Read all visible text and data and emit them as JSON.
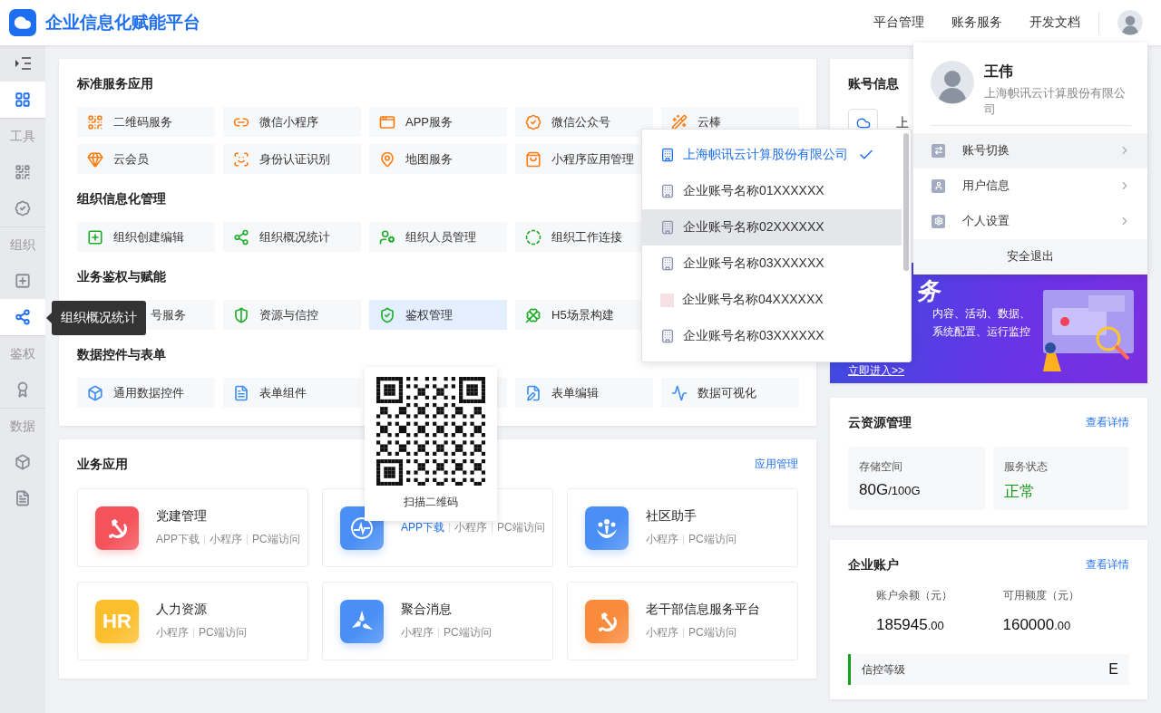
{
  "header": {
    "title": "企业信息化赋能平台",
    "nav": [
      "平台管理",
      "账务服务",
      "开发文档"
    ]
  },
  "sidebar": {
    "items": [
      {
        "kind": "toggle",
        "selected": false
      },
      {
        "kind": "grid",
        "selected": true
      },
      {
        "kind": "label",
        "label": "工具",
        "selected": false
      },
      {
        "kind": "qr",
        "selected": false
      },
      {
        "kind": "badge",
        "selected": false
      },
      {
        "kind": "label",
        "label": "组织",
        "selected": false
      },
      {
        "kind": "add",
        "selected": false
      },
      {
        "kind": "nodes",
        "selected": true
      },
      {
        "kind": "label",
        "label": "鉴权",
        "selected": false
      },
      {
        "kind": "medal",
        "selected": false
      },
      {
        "kind": "label",
        "label": "数据",
        "selected": false
      },
      {
        "kind": "cube",
        "selected": false
      },
      {
        "kind": "doc",
        "selected": false
      }
    ]
  },
  "services": {
    "sections": [
      {
        "title": "标准服务应用",
        "items": [
          {
            "kind": "qr",
            "label": "二维码服务",
            "selected": false
          },
          {
            "kind": "miniapp",
            "label": "微信小程序",
            "selected": false
          },
          {
            "kind": "app",
            "label": "APP服务",
            "selected": false
          },
          {
            "kind": "badge",
            "label": "微信公众号",
            "selected": false
          },
          {
            "kind": "wand",
            "label": "云棒",
            "selected": false
          },
          {
            "kind": "gem",
            "label": "云会员",
            "selected": false
          },
          {
            "kind": "face",
            "label": "身份认证识别",
            "selected": false
          },
          {
            "kind": "pin",
            "label": "地图服务",
            "selected": false
          },
          {
            "kind": "bag",
            "label": "小程序应用管理",
            "selected": false
          }
        ]
      },
      {
        "title": "组织信息化管理",
        "items": [
          {
            "kind": "add",
            "label": "组织创建编辑",
            "selected": false
          },
          {
            "kind": "nodes",
            "label": "组织概况统计",
            "selected": false
          },
          {
            "kind": "usercog",
            "label": "组织人员管理",
            "selected": false
          },
          {
            "kind": "ring",
            "label": "组织工作连接",
            "selected": false
          }
        ]
      },
      {
        "title": "业务鉴权与赋能",
        "items": [
          {
            "kind": "clipped",
            "label": "号服务",
            "selected": false
          },
          {
            "kind": "shield",
            "label": "资源与信控",
            "selected": false
          },
          {
            "kind": "shieldcheck",
            "label": "鉴权管理",
            "selected": true
          },
          {
            "kind": "clover",
            "label": "H5场景构建",
            "selected": false
          }
        ]
      },
      {
        "title": "数据控件与表单",
        "items": [
          {
            "kind": "box",
            "label": "通用数据控件",
            "selected": false
          },
          {
            "kind": "form",
            "label": "表单组件",
            "selected": false
          },
          {
            "kind": "blank",
            "selected": false
          },
          {
            "kind": "edit",
            "label": "表单编辑",
            "selected": false
          },
          {
            "kind": "chart",
            "label": "数据可视化",
            "selected": false
          }
        ]
      }
    ]
  },
  "apps": {
    "title": "业务应用",
    "link": "应用管理",
    "items": [
      {
        "kind": "emblem",
        "title": "党建管理",
        "color": "#f5535b",
        "links": [
          {
            "label": "APP下载",
            "selected": false
          },
          {
            "label": "小程序",
            "selected": false
          },
          {
            "label": "PC端访问",
            "selected": false
          }
        ]
      },
      {
        "kind": "monitor",
        "color": "#4a8ff5",
        "links": [
          {
            "label": "APP下载",
            "selected": true
          },
          {
            "label": "小程序",
            "selected": false
          },
          {
            "label": "PC端访问",
            "selected": false
          }
        ]
      },
      {
        "kind": "people",
        "title": "社区助手",
        "color": "#4a8ff5",
        "links": [
          {
            "label": "小程序",
            "selected": false
          },
          {
            "label": "PC端访问",
            "selected": false
          }
        ]
      },
      {
        "kind": "text",
        "icon_text": "HR",
        "title": "人力资源",
        "color": "#fbbf2e",
        "links": [
          {
            "label": "小程序",
            "selected": false
          },
          {
            "label": "PC端访问",
            "selected": false
          }
        ]
      },
      {
        "kind": "triad",
        "title": "聚合消息",
        "color": "#4a8ff5",
        "links": [
          {
            "label": "小程序",
            "selected": false
          },
          {
            "label": "PC端访问",
            "selected": false
          }
        ]
      },
      {
        "kind": "emblem",
        "title": "老干部信息服务平台",
        "color": "#f98b3d",
        "links": [
          {
            "label": "小程序",
            "selected": false
          },
          {
            "label": "PC端访问",
            "selected": false
          }
        ]
      }
    ]
  },
  "account_info": {
    "title": "账号信息",
    "company": "上",
    "banner": {
      "headline": "务",
      "lines": [
        "内容、活动、数据、",
        "系统配置、运行监控"
      ],
      "cta": "立即进入>>"
    }
  },
  "cloud": {
    "title": "云资源管理",
    "link": "查看详情",
    "storage": {
      "label": "存储空间",
      "value": "80G",
      "total": "/100G"
    },
    "status": {
      "label": "服务状态",
      "value": "正常"
    }
  },
  "enterprise": {
    "title": "企业账户",
    "link": "查看详情",
    "stats": [
      {
        "label": "账户余额（元）",
        "value": "185945",
        "decimals": ".00"
      },
      {
        "label": "可用额度（元）",
        "value": "160000",
        "decimals": ".00"
      }
    ],
    "credit": {
      "label": "信控等级",
      "value": "E"
    }
  },
  "tooltip": {
    "text": "组织概况统计"
  },
  "qr_popup": {
    "caption": "扫描二维码"
  },
  "account_menu": {
    "items": [
      {
        "kind": "building",
        "label": "上海帜讯云计算股份有限公司",
        "selected": true,
        "hovered": false
      },
      {
        "kind": "building",
        "label": "企业账号名称01XXXXXX",
        "selected": false,
        "hovered": false
      },
      {
        "kind": "building",
        "label": "企业账号名称02XXXXXX",
        "selected": false,
        "hovered": true
      },
      {
        "kind": "building",
        "label": "企业账号名称03XXXXXX",
        "selected": false,
        "hovered": false
      },
      {
        "kind": "blank",
        "label": "企业账号名称04XXXXXX",
        "selected": false,
        "hovered": false
      },
      {
        "kind": "building",
        "label": "企业账号名称03XXXXXX",
        "selected": false,
        "hovered": false
      }
    ]
  },
  "user_menu": {
    "name": "王伟",
    "company": "上海帜讯云计算股份有限公司",
    "items": [
      {
        "kind": "switch",
        "label": "账号切换",
        "selected": true
      },
      {
        "kind": "user",
        "label": "用户信息",
        "selected": false
      },
      {
        "kind": "settings",
        "label": "个人设置",
        "selected": false
      }
    ],
    "logout": "安全退出"
  }
}
